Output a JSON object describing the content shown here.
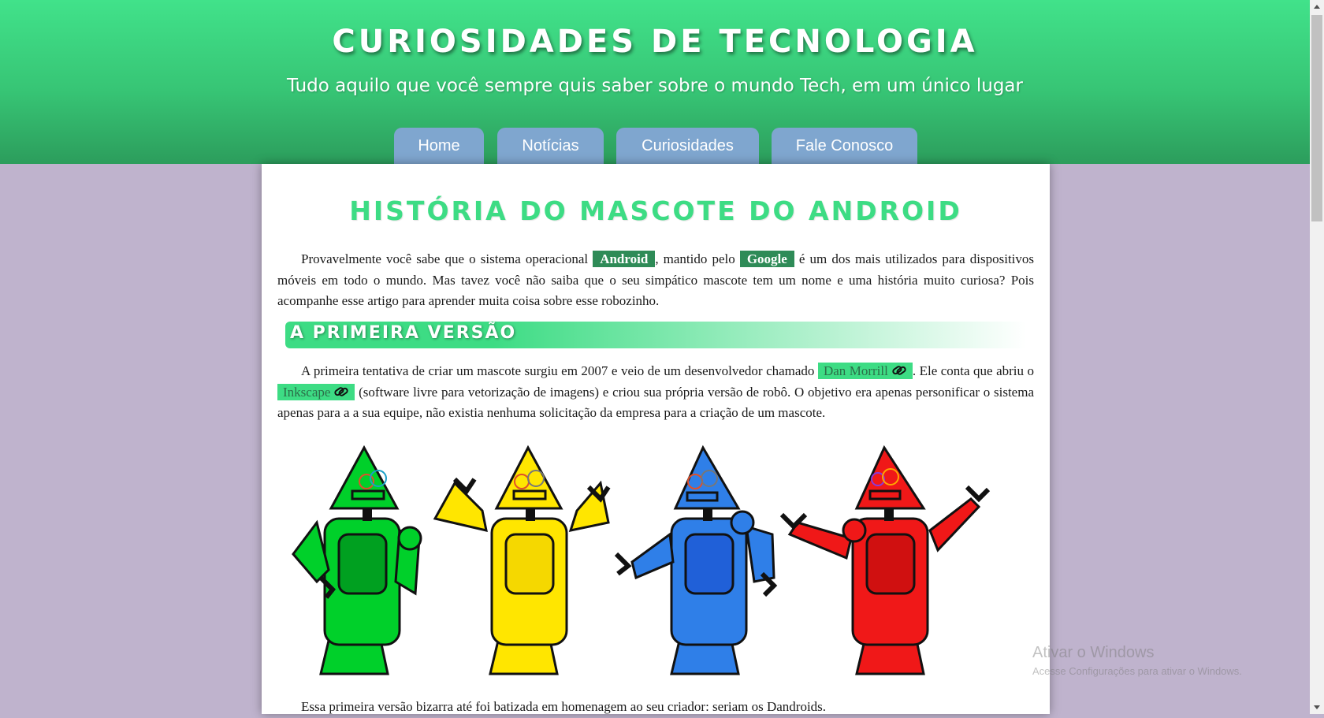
{
  "header": {
    "title": "Curiosidades de Tecnologia",
    "subtitle": "Tudo aquilo que você sempre quis saber sobre o mundo Tech, em um único lugar"
  },
  "menu": {
    "items": [
      {
        "label": "Home"
      },
      {
        "label": "Notícias"
      },
      {
        "label": "Curiosidades"
      },
      {
        "label": "Fale Conosco"
      }
    ]
  },
  "article": {
    "title": "História do mascote do Android",
    "intro": {
      "t1": "Provavelmente você sabe que o sistema operacional ",
      "android": "Android",
      "t2": ", mantido pelo ",
      "google": "Google",
      "t3": " é um dos mais utilizados para dispositivos móveis em todo o mundo. Mas tavez você não saiba que o seu simpático mascote tem um nome e uma história muito curiosa? Pois acompanhe esse artigo para aprender muita coisa sobre esse robozinho."
    },
    "section1": {
      "heading": "A primeira versão",
      "t1": "A primeira tentativa de criar um mascote surgiu em 2007 e veio de um desenvolvedor chamado ",
      "link1": "Dan Morrill",
      "t2": ". Ele conta que abriu o ",
      "link2": "Inkscape",
      "t3": " (software livre para vetorização de imagens) e criou sua própria versão de robô. O objetivo era apenas personificar o sistema apenas para a a sua equipe, não existia nenhuma solicitação da empresa para a criação de um mascote."
    },
    "robot_colors": [
      "#00d02a",
      "#ffe600",
      "#2f7fe8",
      "#f01818"
    ],
    "caption_partial": "Essa primeira versão bizarra até foi batizada em homenagem ao seu criador: seriam os Dandroids."
  },
  "colors": {
    "header_green": "#3ddc84",
    "menu_blue": "#7fa6cf",
    "page_bg": "#bfb3cd",
    "tag_dark_green": "#2e8b57"
  },
  "watermark": {
    "title": "Ativar o Windows",
    "subtitle": "Acesse Configurações para ativar o Windows."
  },
  "icons": [
    "paperclip-icon",
    "scroll-up-arrow-icon",
    "scroll-down-arrow-icon"
  ]
}
